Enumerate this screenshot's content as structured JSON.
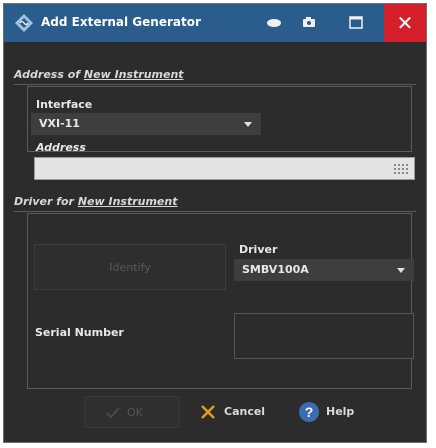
{
  "window": {
    "title": "Add External Generator",
    "close_glyph": "✕"
  },
  "address_section": {
    "label_prefix": "Address of ",
    "label_underlined": "New Instrument",
    "interface": {
      "label": "Interface",
      "value": "VXI-11"
    },
    "address": {
      "label": "Address",
      "value": ""
    }
  },
  "driver_section": {
    "label_prefix": "Driver for ",
    "label_underlined": "New Instrument",
    "identify_label": "Identify",
    "driver": {
      "label": "Driver",
      "value": "SMBV100A"
    },
    "serial_number_label": "Serial Number",
    "serial_number_value": ""
  },
  "buttons": {
    "ok": "OK",
    "cancel": "Cancel",
    "help": "Help"
  },
  "colors": {
    "titlebar": "#2a5d8c",
    "close": "#d41f2a",
    "background": "#2c2c2c",
    "cancel_x": "#e0a020",
    "help_icon": "#3a6db0"
  }
}
